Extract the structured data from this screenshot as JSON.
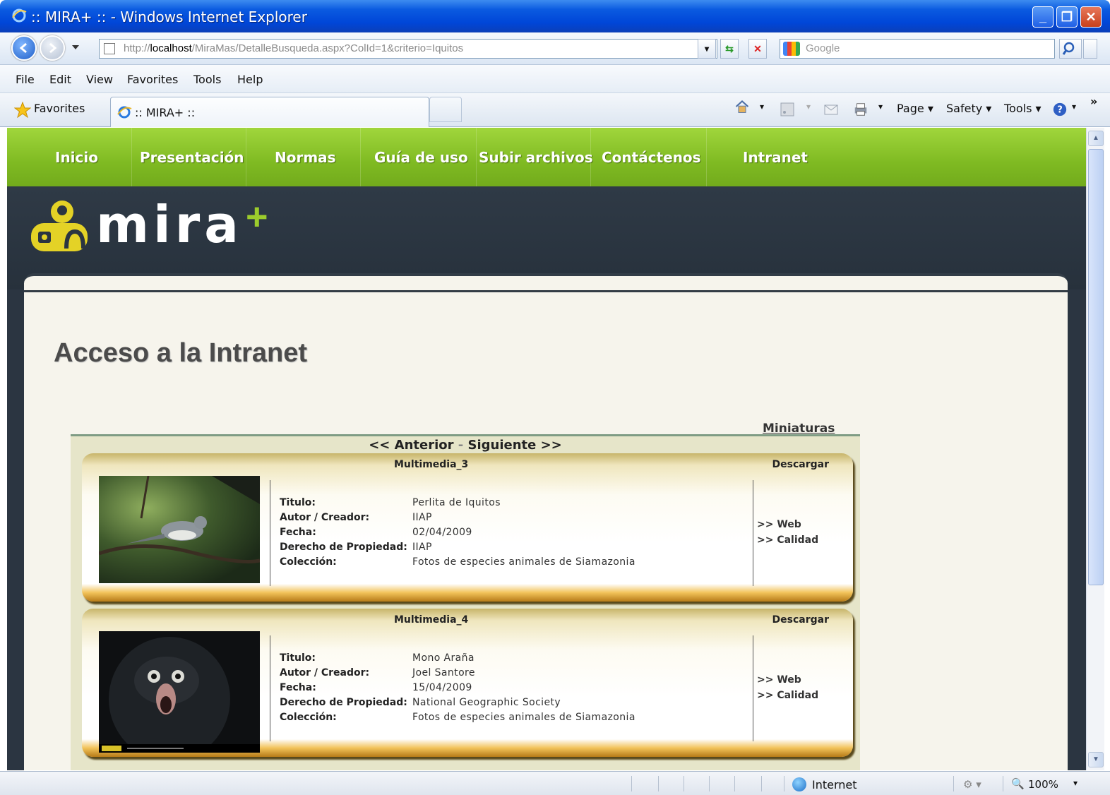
{
  "window": {
    "title": ":: MIRA+ :: - Windows Internet Explorer",
    "minimize": "_",
    "restore": "❐",
    "close": "✕"
  },
  "address": {
    "url_prefix": "http://",
    "url_host": "localhost",
    "url_path": "/MiraMas/DetalleBusqueda.aspx?ColId=1&criterio=Iquitos",
    "search_placeholder": "Google"
  },
  "menu": [
    "File",
    "Edit",
    "View",
    "Favorites",
    "Tools",
    "Help"
  ],
  "favorites_label": "Favorites",
  "tab": {
    "title": ":: MIRA+ ::"
  },
  "commands": {
    "page": "Page ▾",
    "safety": "Safety ▾",
    "tools": "Tools ▾",
    "more": "»"
  },
  "site": {
    "nav": [
      "Inicio",
      "Presentación",
      "Normas",
      "Guía de uso",
      "Subir archivos",
      "Contáctenos",
      "Intranet"
    ],
    "logo_text": "mira",
    "logo_plus": "+",
    "page_title": "Acceso a la Intranet",
    "miniaturas": "Miniaturas",
    "pager": {
      "prev": "<< Anterior",
      "dash": " - ",
      "next": "Siguiente >>"
    },
    "labels": {
      "titulo": "Titulo:",
      "autor": "Autor / Creador:",
      "fecha": "Fecha:",
      "derecho": "Derecho de Propiedad:",
      "coleccion": "Colección:",
      "descargar": "Descargar",
      "web": ">> Web",
      "calidad": ">> Calidad"
    },
    "items": [
      {
        "name": "Multimedia_3",
        "titulo": "Perlita de Iquitos",
        "autor": "IIAP",
        "fecha": "02/04/2009",
        "derecho": "IIAP",
        "coleccion": "Fotos de especies animales de Siamazonia"
      },
      {
        "name": "Multimedia_4",
        "titulo": "Mono Araña",
        "autor": "Joel Santore",
        "fecha": "15/04/2009",
        "derecho": "National Geographic Society",
        "coleccion": "Fotos de especies animales de Siamazonia"
      }
    ]
  },
  "status": {
    "zone": "Internet",
    "zoom": "100%"
  }
}
